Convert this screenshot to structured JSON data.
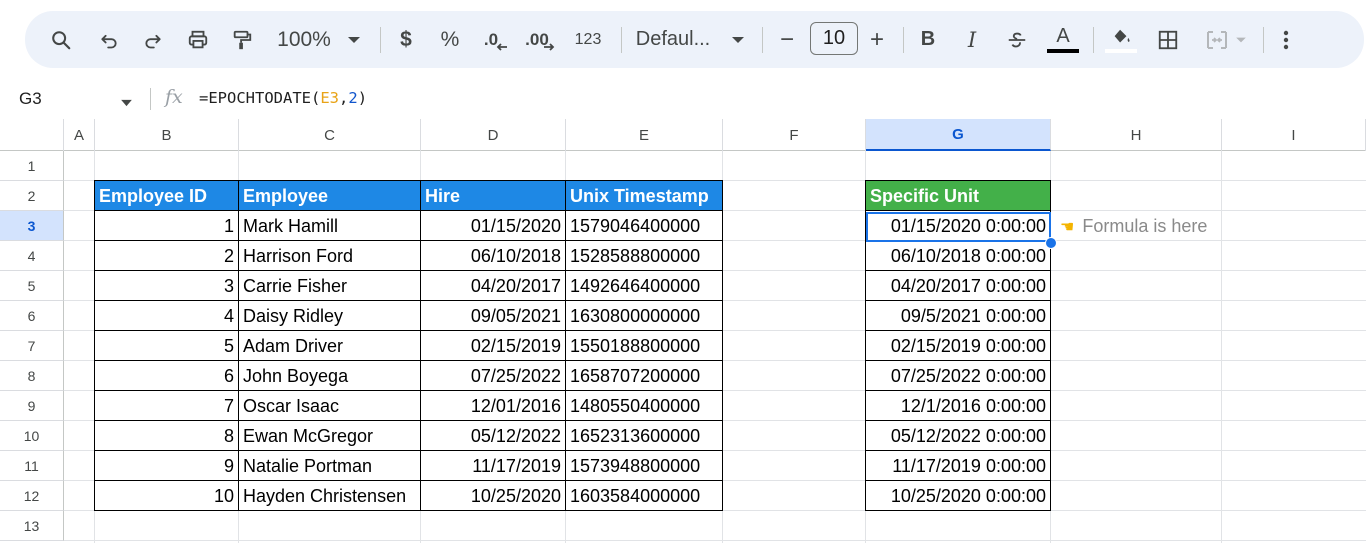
{
  "toolbar": {
    "zoom": "100%",
    "currency": "$",
    "percent": "%",
    "decrease_decimal": ".0",
    "increase_decimal": ".00",
    "format_123": "123",
    "font": "Defaul...",
    "font_size": "10",
    "minus": "−",
    "plus": "+",
    "bold": "B",
    "italic": "I",
    "text_color_letter": "A"
  },
  "formula_bar": {
    "name_box": "G3",
    "fx": "fx",
    "formula_prefix": "=EPOCHTODATE(",
    "formula_ref": "E3",
    "formula_sep": ",",
    "formula_num": "2",
    "formula_suffix": ")"
  },
  "columns": [
    "A",
    "B",
    "C",
    "D",
    "E",
    "F",
    "G",
    "H",
    "I"
  ],
  "active_column": "G",
  "rows": [
    "1",
    "2",
    "3",
    "4",
    "5",
    "6",
    "7",
    "8",
    "9",
    "10",
    "11",
    "12",
    "13"
  ],
  "active_row": "3",
  "table": {
    "headers": [
      "Employee ID",
      "Employee",
      "Hire",
      "Unix Timestamp"
    ],
    "rows": [
      [
        "1",
        "Mark Hamill",
        "01/15/2020",
        "1579046400000"
      ],
      [
        "2",
        "Harrison Ford",
        "06/10/2018",
        "1528588800000"
      ],
      [
        "3",
        "Carrie Fisher",
        "04/20/2017",
        "1492646400000"
      ],
      [
        "4",
        "Daisy Ridley",
        "09/05/2021",
        "1630800000000"
      ],
      [
        "5",
        "Adam Driver",
        "02/15/2019",
        "1550188800000"
      ],
      [
        "6",
        "John Boyega",
        "07/25/2022",
        "1658707200000"
      ],
      [
        "7",
        "Oscar Isaac",
        "12/01/2016",
        "1480550400000"
      ],
      [
        "8",
        "Ewan McGregor",
        "05/12/2022",
        "1652313600000"
      ],
      [
        "9",
        "Natalie Portman",
        "11/17/2019",
        "1573948800000"
      ],
      [
        "10",
        "Hayden Christensen",
        "10/25/2020",
        "1603584000000"
      ]
    ]
  },
  "result": {
    "header": "Specific Unit",
    "values": [
      "01/15/2020 0:00:00",
      "06/10/2018 0:00:00",
      "04/20/2017 0:00:00",
      "09/5/2021 0:00:00",
      "02/15/2019 0:00:00",
      "07/25/2022 0:00:00",
      "12/1/2016 0:00:00",
      "05/12/2022 0:00:00",
      "11/17/2019 0:00:00",
      "10/25/2020 0:00:00"
    ]
  },
  "note": "Formula is here",
  "colors": {
    "header_blue": "#1e88e5",
    "header_green": "#43b049",
    "selection": "#1a73e8",
    "formula_ref": "#e8a317"
  },
  "icons": [
    "search-icon",
    "undo-icon",
    "redo-icon",
    "print-icon",
    "paint-format-icon",
    "chevron-down-icon",
    "strikethrough-icon",
    "fill-color-icon",
    "borders-icon",
    "merge-cells-icon",
    "more-vert-icon",
    "fx-icon",
    "pointing-hand-icon"
  ]
}
